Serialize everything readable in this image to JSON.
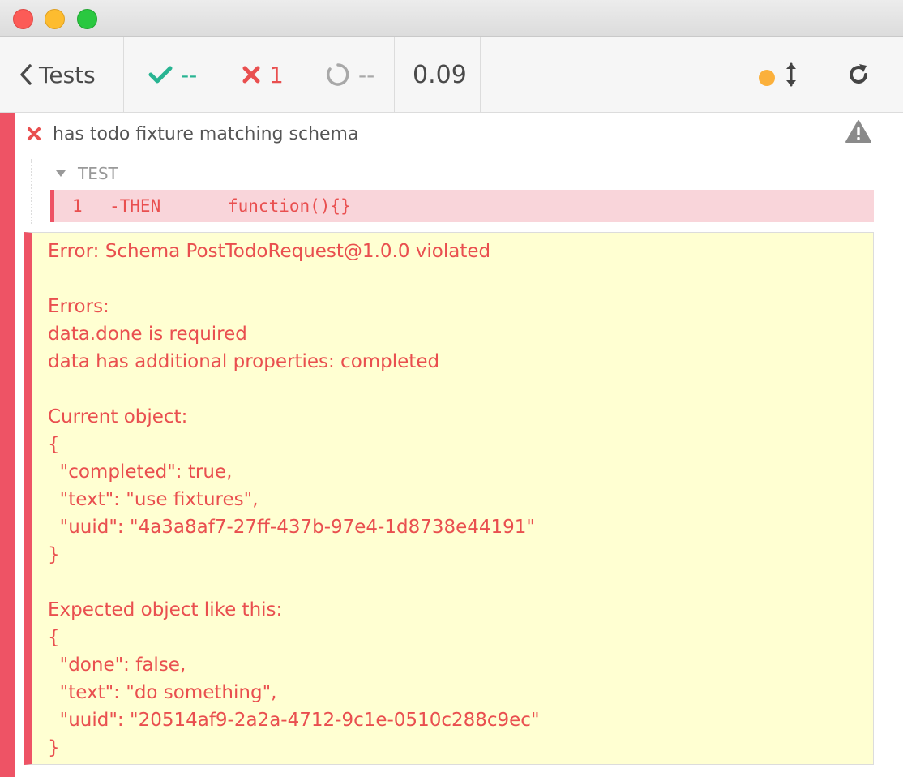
{
  "header": {
    "back_label": "Tests",
    "passed": "--",
    "failed": "1",
    "pending": "--",
    "duration": "0.09"
  },
  "colors": {
    "fail": "#ee5365",
    "pass": "#28b492",
    "error_bg": "#ffffd2",
    "running_dot": "#fbb03b"
  },
  "test": {
    "title": "has todo fixture matching schema",
    "hook_label": "TEST",
    "command": {
      "number": "1",
      "name": "-THEN",
      "message": "function(){}"
    }
  },
  "error": {
    "lines": [
      "Error: Schema PostTodoRequest@1.0.0 violated",
      "",
      "Errors:",
      "data.done is required",
      "data has additional properties: completed",
      "",
      "Current object:",
      "{",
      "  \"completed\": true,",
      "  \"text\": \"use fixtures\",",
      "  \"uuid\": \"4a3a8af7-27ff-437b-97e4-1d8738e44191\"",
      "}",
      "",
      "Expected object like this:",
      "{",
      "  \"done\": false,",
      "  \"text\": \"do something\",",
      "  \"uuid\": \"20514af9-2a2a-4712-9c1e-0510c288c9ec\"",
      "}"
    ]
  }
}
